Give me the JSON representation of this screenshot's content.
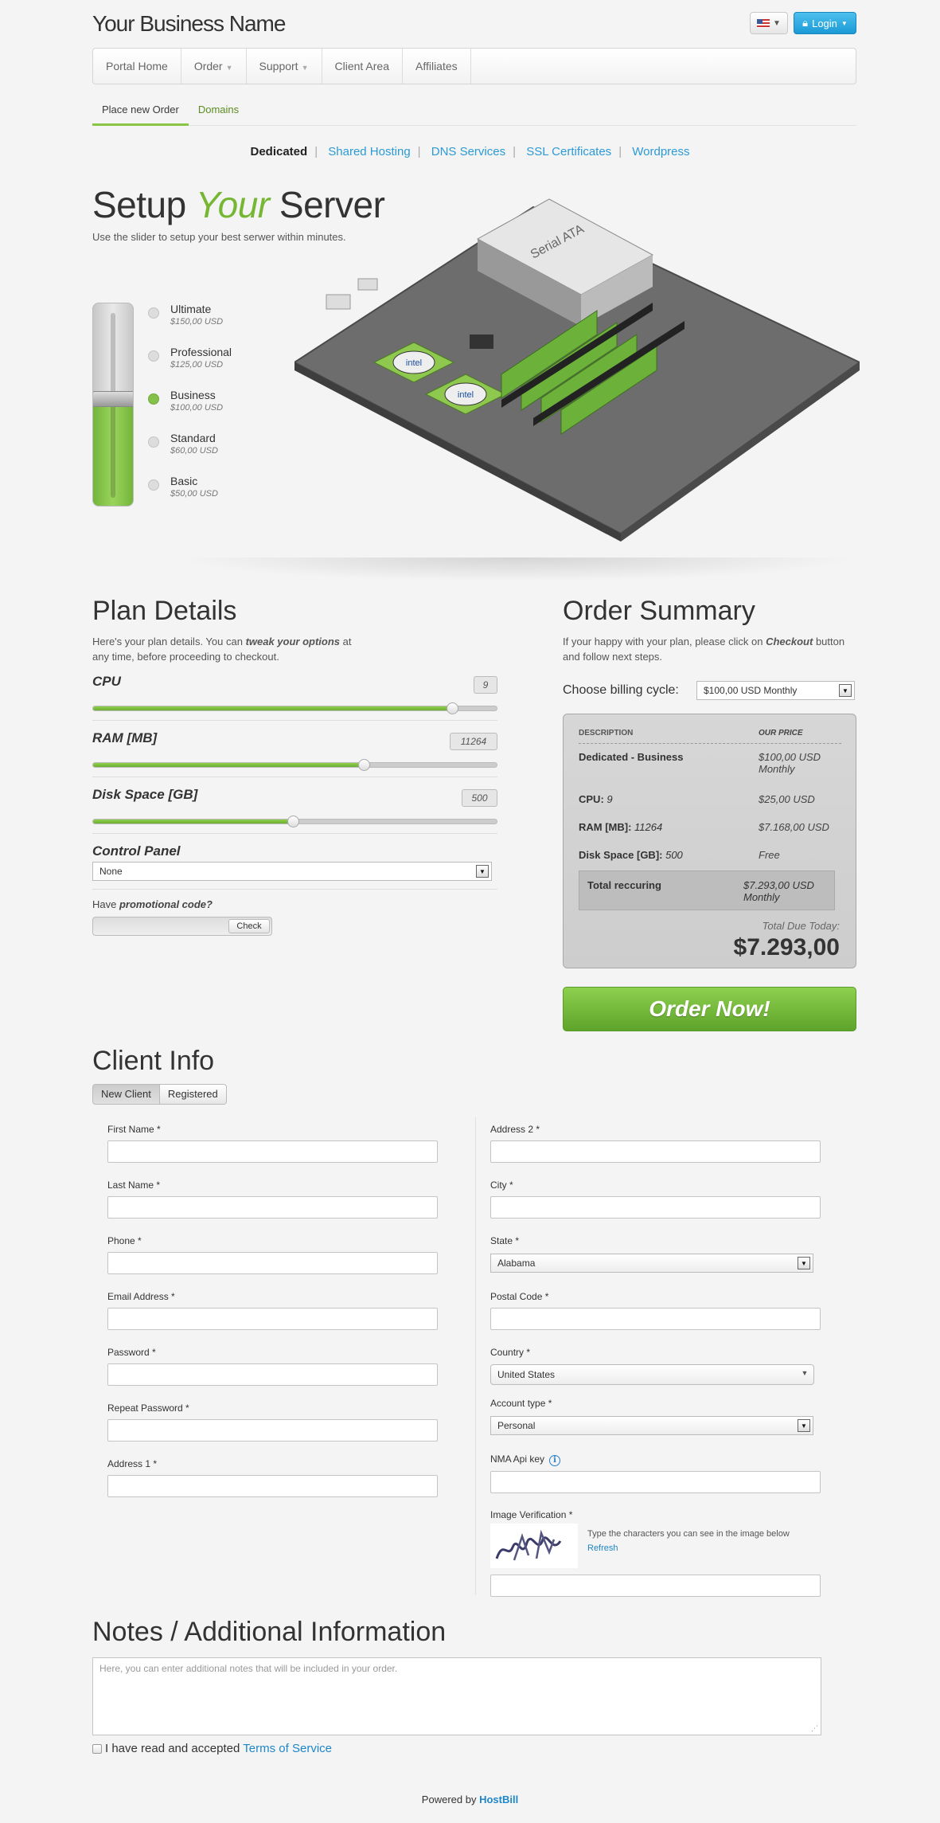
{
  "header": {
    "brand": "Your Business Name",
    "login_label": "Login"
  },
  "nav": {
    "items": [
      {
        "label": "Portal Home"
      },
      {
        "label": "Order"
      },
      {
        "label": "Support"
      },
      {
        "label": "Client Area"
      },
      {
        "label": "Affiliates"
      }
    ]
  },
  "subtabs": [
    "Place new Order",
    "Domains"
  ],
  "products": [
    "Dedicated",
    "Shared Hosting",
    "DNS Services",
    "SSL Certificates",
    "Wordpress"
  ],
  "hero": {
    "title_a": "Setup ",
    "title_b": "Your",
    "title_c": " Server",
    "subtitle": "Use the slider to setup your best serwer within minutes."
  },
  "plans": [
    {
      "name": "Ultimate",
      "price": "$150,00 USD"
    },
    {
      "name": "Professional",
      "price": "$125,00 USD"
    },
    {
      "name": "Business",
      "price": "$100,00 USD"
    },
    {
      "name": "Standard",
      "price": "$60,00 USD"
    },
    {
      "name": "Basic",
      "price": "$50,00 USD"
    }
  ],
  "selected_plan": "Business",
  "server_chips": [
    "intel",
    "intel",
    "Serial ATA"
  ],
  "plan_details": {
    "title": "Plan Details",
    "desc_a": "Here's your plan details. You can ",
    "desc_b": "tweak your options",
    "desc_c": " at any time, before proceeding to checkout.",
    "options": [
      {
        "label": "CPU",
        "value": "9",
        "fraction": 0.89
      },
      {
        "label": "RAM [MB]",
        "value": "11264",
        "fraction": 0.67
      },
      {
        "label": "Disk Space [GB]",
        "value": "500",
        "fraction": 0.495
      }
    ],
    "control_panel_label": "Control Panel",
    "control_panel_value": "None",
    "promo_a": "Have ",
    "promo_b": "promotional code?",
    "promo_button": "Check"
  },
  "order_summary": {
    "title": "Order Summary",
    "desc_a": "If your happy with your plan, please click on ",
    "desc_b": "Checkout",
    "desc_c": " button and follow next steps.",
    "billing_label": "Choose billing cycle:",
    "billing_value": "$100,00 USD Monthly",
    "col_desc": "DESCRIPTION",
    "col_price": "OUR PRICE",
    "rows": [
      {
        "desc": "Dedicated - Business",
        "price": "$100,00 USD",
        "price2": "Monthly"
      },
      {
        "desc": "CPU: ",
        "val": "9",
        "price": "$25,00 USD"
      },
      {
        "desc": "RAM [MB]: ",
        "val": "11264",
        "price": "$7.168,00 USD"
      },
      {
        "desc": "Disk Space [GB]: ",
        "val": "500",
        "price": "Free"
      }
    ],
    "total_label": "Total reccuring",
    "total_price": "$7.293,00 USD",
    "total_price2": "Monthly",
    "due_label": "Total Due Today:",
    "due_value": "$7.293,00",
    "order_button": "Order Now!"
  },
  "client_info": {
    "title": "Client Info",
    "tabs": [
      "New Client",
      "Registered"
    ],
    "left_fields": [
      "First Name *",
      "Last Name *",
      "Phone *",
      "Email Address *",
      "Password *",
      "Repeat Password *",
      "Address 1 *"
    ],
    "address2": "Address 2 *",
    "city": "City *",
    "state_label": "State *",
    "state_value": "Alabama",
    "postal": "Postal Code *",
    "country_label": "Country *",
    "country_value": "United States",
    "account_type_label": "Account type *",
    "account_type_value": "Personal",
    "api_key_label": "NMA Api key",
    "captcha_label": "Image Verification *",
    "captcha_text": "Type the characters you can see in the image below",
    "captcha_refresh": "Refresh"
  },
  "notes": {
    "title": "Notes / Additional Information",
    "placeholder": "Here, you can enter additional notes that will be included in your order.",
    "tos_a": "I have read and accepted ",
    "tos_link": "Terms of Service"
  },
  "footer": {
    "powered": "Powered by ",
    "link": "HostBill"
  },
  "colors": {
    "accent_green": "#75b733",
    "link_blue": "#2b9ad6",
    "login_blue": "#1c9ad6"
  }
}
